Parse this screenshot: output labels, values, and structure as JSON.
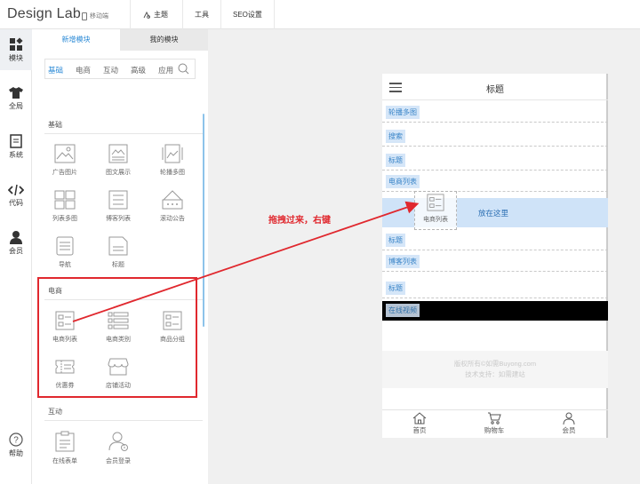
{
  "app": {
    "logo": "Design Lab",
    "mobile_label": "移动端",
    "topnav": [
      "主题",
      "工具",
      "SEO设置"
    ]
  },
  "leftnav": [
    {
      "label": "模块",
      "icon": "modules-icon"
    },
    {
      "label": "全局",
      "icon": "shirt-icon"
    },
    {
      "label": "系统",
      "icon": "document-icon"
    },
    {
      "label": "代码",
      "icon": "code-icon"
    },
    {
      "label": "会员",
      "icon": "user-icon"
    },
    {
      "label": "帮助",
      "icon": "help-icon"
    }
  ],
  "panel": {
    "tabs": [
      "新增模块",
      "我的模块"
    ],
    "categories": [
      "基础",
      "电商",
      "互动",
      "高级",
      "应用"
    ],
    "search": {
      "placeholder": ""
    },
    "sections": {
      "basic": {
        "title": "基础",
        "items": [
          "广告图片",
          "图文展示",
          "轮播多图",
          "列表多图",
          "博客列表",
          "滚动公告",
          "导航",
          "标题"
        ]
      },
      "ecommerce": {
        "title": "电商",
        "items": [
          "电商列表",
          "电商类别",
          "商品分组",
          "优惠券",
          "店铺活动"
        ]
      },
      "interactive": {
        "title": "互动",
        "items": [
          "在线表单",
          "会员登录"
        ]
      }
    }
  },
  "annotation": "拖拽过来，右键",
  "phone": {
    "title": "标题",
    "modules": [
      "轮播多图",
      "搜索",
      "标题",
      "电商列表",
      "标题",
      "博客列表",
      "标题"
    ],
    "drop_text": "放在这里",
    "drag_item": "电商列表",
    "video_label": "在线视频",
    "footer_line1": "版权所有©如需Buyong.com",
    "footer_line2": "技术支持：如需建站",
    "tabbar": [
      "首页",
      "购物车",
      "会员"
    ]
  },
  "colors": {
    "accent": "#2b8ad6",
    "annotation": "#e0282e",
    "tag_bg": "#d5e6f8"
  }
}
